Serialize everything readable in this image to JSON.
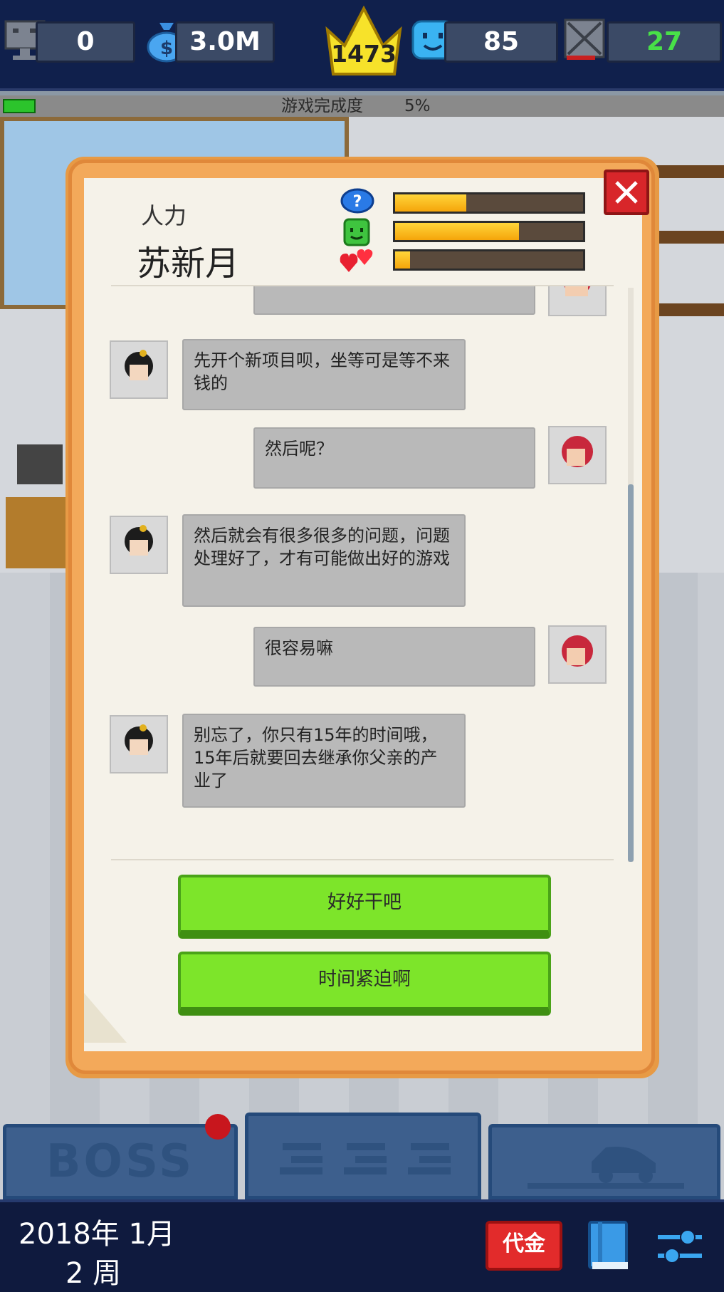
{
  "topbar": {
    "stats": [
      {
        "name": "games",
        "icon": "computer-icon",
        "value": "0"
      },
      {
        "name": "money",
        "icon": "money-bag-icon",
        "value": "3.0M"
      },
      {
        "name": "fans",
        "icon": "happy-face-icon",
        "value": "85"
      },
      {
        "name": "bugs",
        "icon": "crossed-box-icon",
        "value": "27"
      }
    ],
    "crown_value": "1473",
    "colors": {
      "bugs_value": "#48e048",
      "default_value": "#ffffff"
    }
  },
  "progress": {
    "label": "游戏完成度",
    "value_text": "5%",
    "fraction": 0.05
  },
  "dialog": {
    "department": "人力",
    "name": "苏新月",
    "meters": [
      {
        "icon": "question-bubble-icon",
        "fraction": 0.38
      },
      {
        "icon": "green-face-icon",
        "fraction": 0.66
      },
      {
        "icon": "hearts-icon",
        "fraction": 0.08
      }
    ],
    "messages": [
      {
        "side": "right",
        "avatar": "red-hair-avatar",
        "text": ""
      },
      {
        "side": "left",
        "avatar": "black-hair-avatar",
        "text": "先开个新项目呗，坐等可是等不来钱的"
      },
      {
        "side": "right",
        "avatar": "red-hair-avatar",
        "text": "然后呢？"
      },
      {
        "side": "left",
        "avatar": "black-hair-avatar",
        "text": "然后就会有很多很多的问题，问题处理好了，才有可能做出好的游戏"
      },
      {
        "side": "right",
        "avatar": "red-hair-avatar",
        "text": "很容易嘛"
      },
      {
        "side": "left",
        "avatar": "black-hair-avatar",
        "text": "别忘了，你只有15年的时间哦，15年后就要回去继承你父亲的产业了"
      }
    ],
    "choices": [
      "好好干吧",
      "时间紧迫啊"
    ]
  },
  "tabs": [
    {
      "label": "BOSS",
      "has_badge": true
    },
    {
      "label": "",
      "icon": "staff-icon"
    },
    {
      "label": "",
      "icon": "car-icon"
    }
  ],
  "bottom": {
    "year_month": "2018年 1月",
    "week": "2 周",
    "redeem_label": "代金",
    "book_icon": "book-icon",
    "settings_icon": "sliders-icon"
  }
}
